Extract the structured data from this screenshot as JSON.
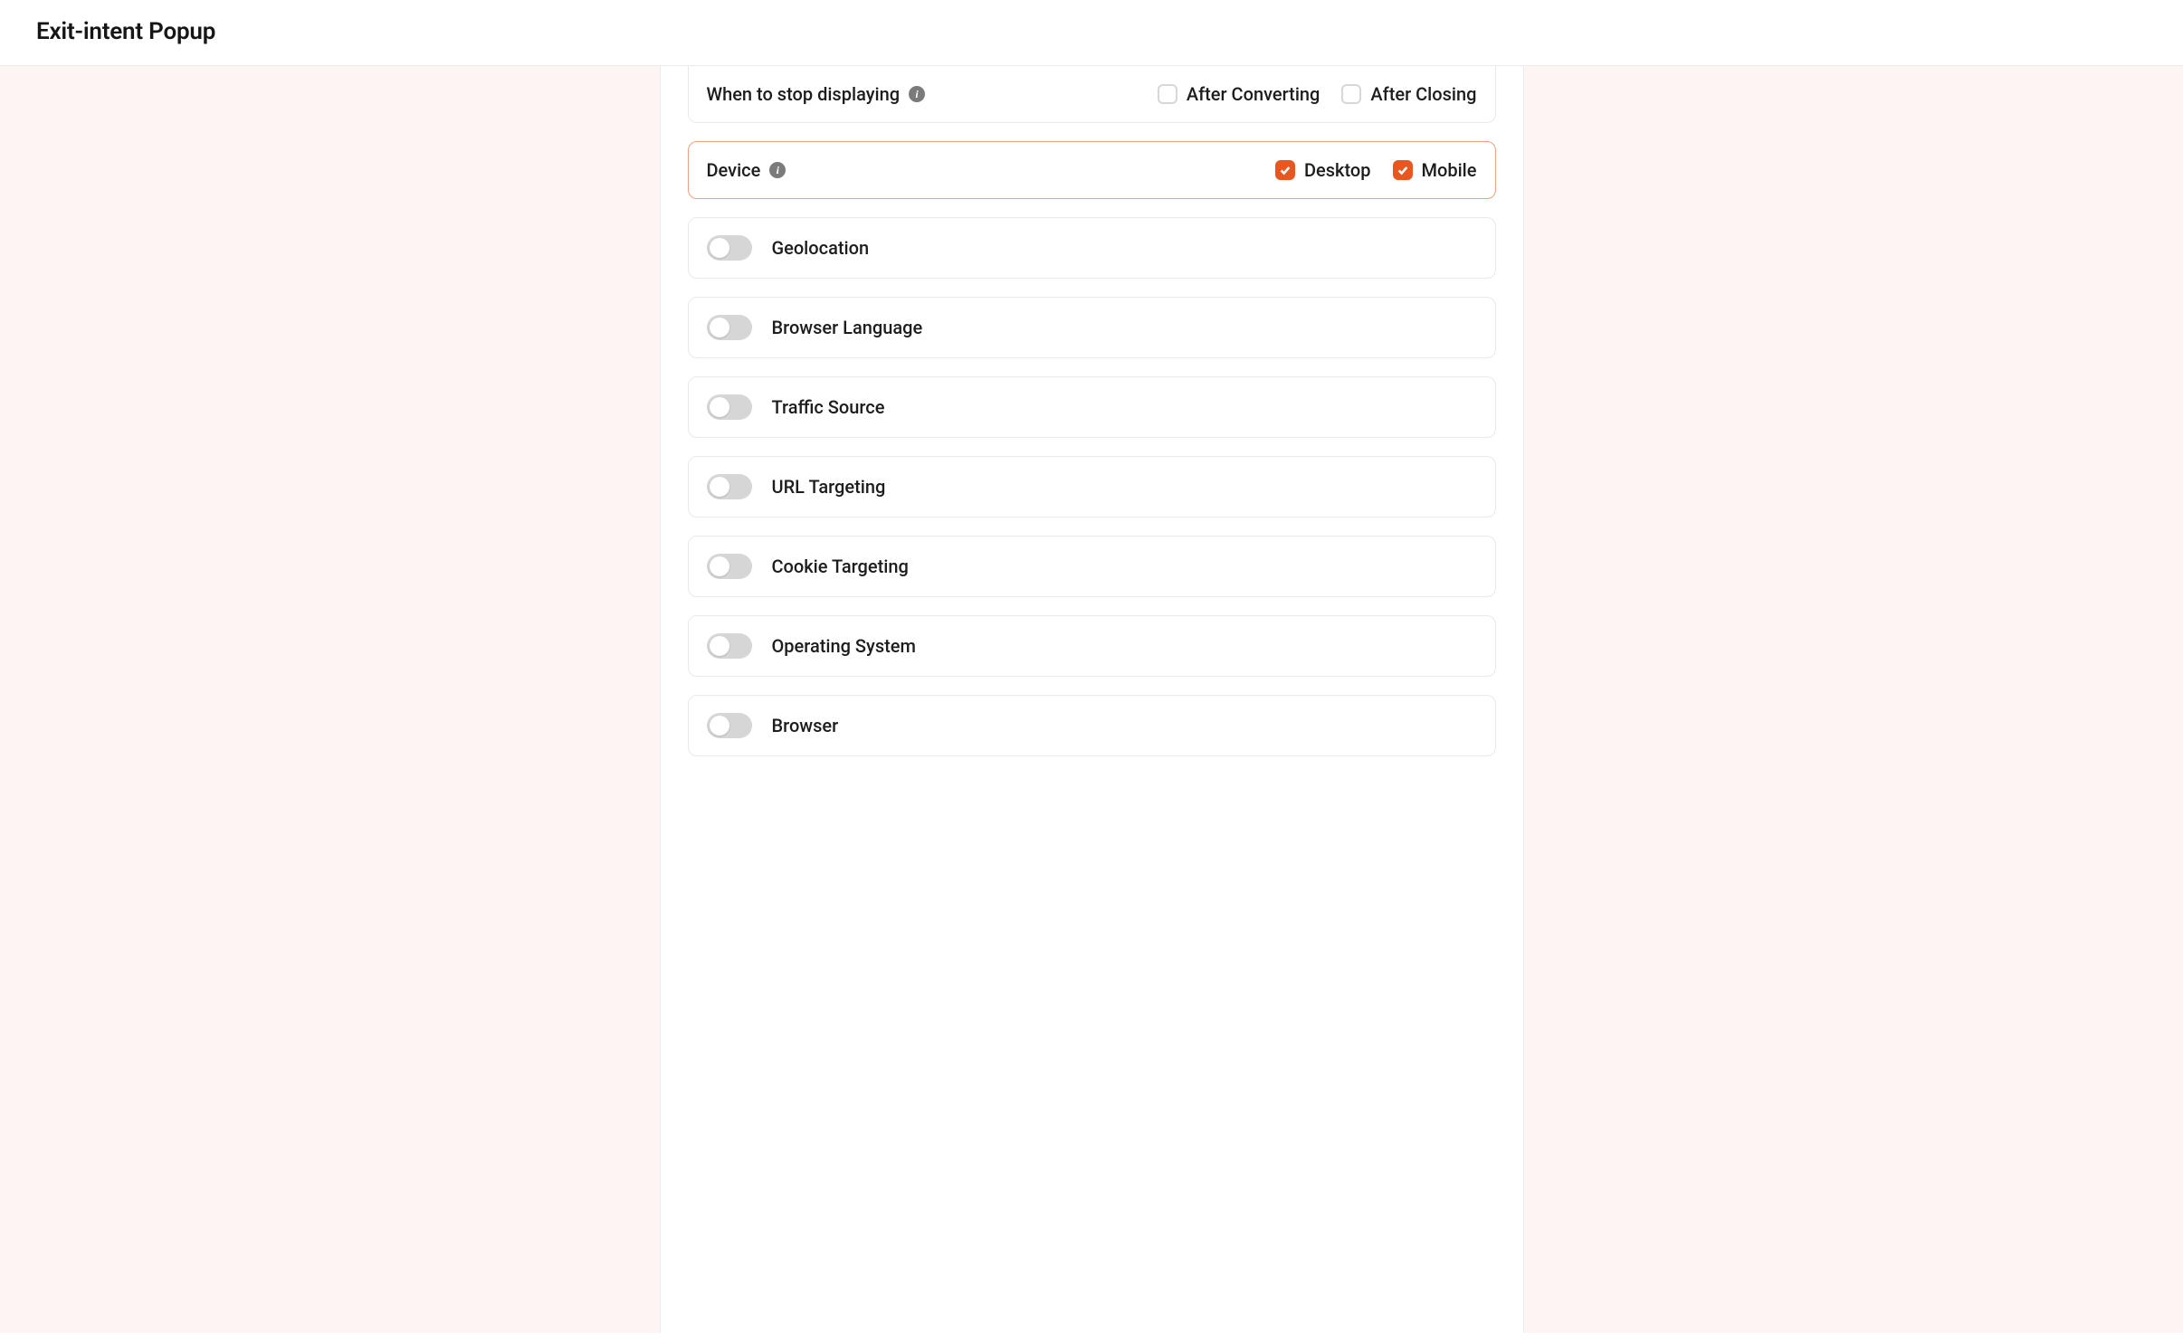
{
  "header": {
    "title": "Exit-intent Popup"
  },
  "rows": {
    "stop_displaying": {
      "label": "When to stop displaying",
      "options": [
        {
          "label": "After Converting",
          "checked": false
        },
        {
          "label": "After Closing",
          "checked": false
        }
      ]
    },
    "device": {
      "label": "Device",
      "options": [
        {
          "label": "Desktop",
          "checked": true
        },
        {
          "label": "Mobile",
          "checked": true
        }
      ]
    }
  },
  "toggles": [
    {
      "label": "Geolocation",
      "on": false
    },
    {
      "label": "Browser Language",
      "on": false
    },
    {
      "label": "Traffic Source",
      "on": false
    },
    {
      "label": "URL Targeting",
      "on": false
    },
    {
      "label": "Cookie Targeting",
      "on": false
    },
    {
      "label": "Operating System",
      "on": false
    },
    {
      "label": "Browser",
      "on": false
    }
  ]
}
